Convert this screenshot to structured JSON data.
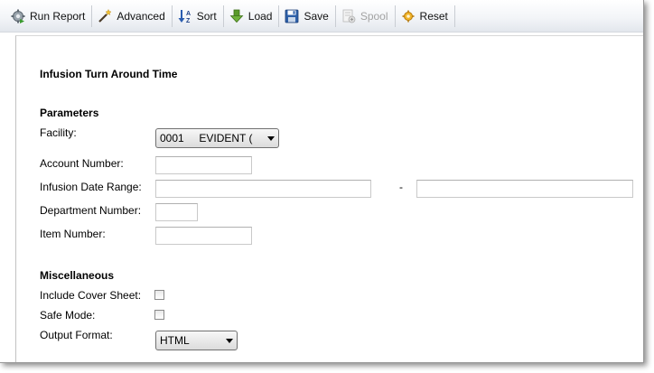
{
  "toolbar": {
    "buttons": [
      {
        "label": "Run Report",
        "icon": "gear-run-icon",
        "enabled": true
      },
      {
        "label": "Advanced",
        "icon": "magic-wand-icon",
        "enabled": true
      },
      {
        "label": "Sort",
        "icon": "sort-icon",
        "enabled": true
      },
      {
        "label": "Load",
        "icon": "load-arrow-icon",
        "enabled": true
      },
      {
        "label": "Save",
        "icon": "floppy-disk-icon",
        "enabled": true
      },
      {
        "label": "Spool",
        "icon": "spool-icon",
        "enabled": false
      },
      {
        "label": "Reset",
        "icon": "reset-icon",
        "enabled": true
      }
    ]
  },
  "report": {
    "title": "Infusion Turn Around Time"
  },
  "parameters": {
    "heading": "Parameters",
    "facility_label": "Facility:",
    "facility_value": "0001     EVIDENT (",
    "account_label": "Account Number:",
    "account_value": "",
    "date_range_label": "Infusion Date Range:",
    "date_from": "",
    "date_separator": "-",
    "date_to": "",
    "department_label": "Department Number:",
    "department_value": "",
    "item_label": "Item Number:",
    "item_value": ""
  },
  "misc": {
    "heading": "Miscellaneous",
    "cover_label": "Include Cover Sheet:",
    "cover_checked": false,
    "safe_label": "Safe Mode:",
    "safe_checked": false,
    "output_label": "Output Format:",
    "output_value": "HTML"
  }
}
